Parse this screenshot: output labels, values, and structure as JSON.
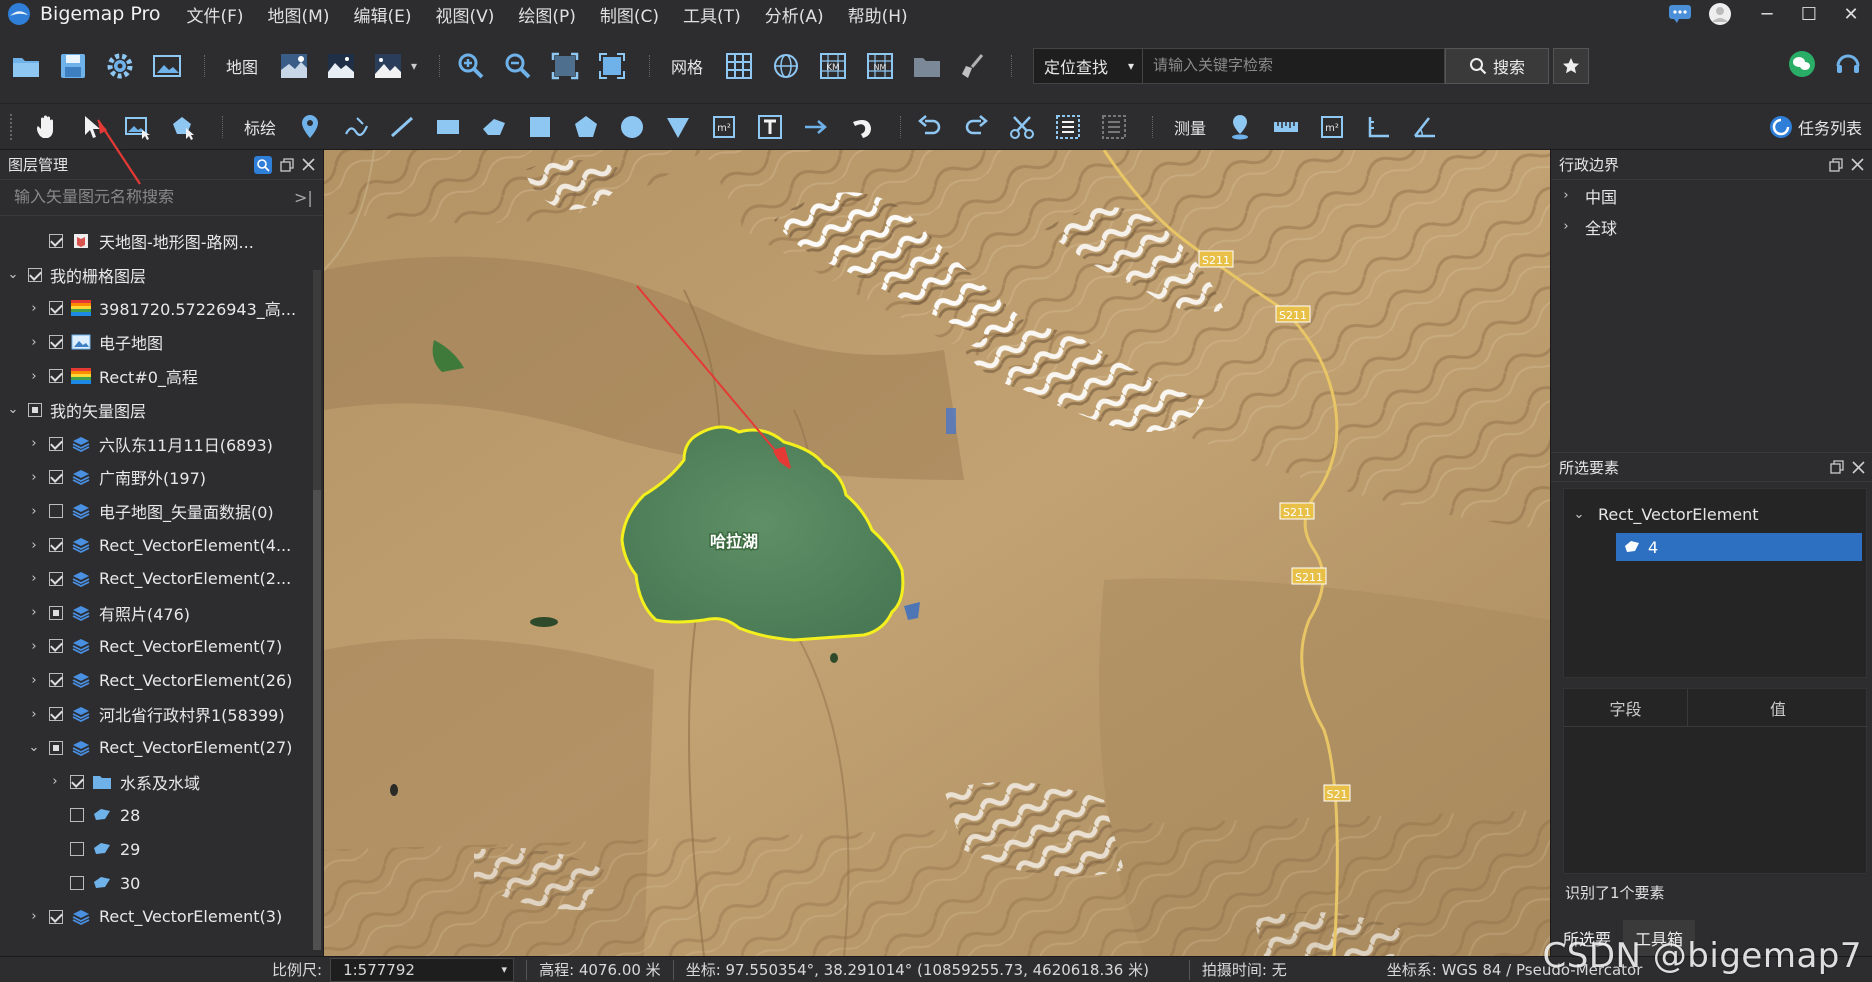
{
  "app": {
    "title": "Bigemap Pro"
  },
  "menu": [
    "文件(F)",
    "地图(M)",
    "编辑(E)",
    "视图(V)",
    "绘图(P)",
    "制图(C)",
    "工具(T)",
    "分析(A)",
    "帮助(H)"
  ],
  "toolbar1": {
    "map_label": "地图",
    "grid_label": "网格",
    "locate_select": "定位查找",
    "search_placeholder": "请输入关键字检索",
    "search_button": "搜索"
  },
  "toolbar2": {
    "annotate_label": "标绘",
    "measure_label": "测量",
    "task_list": "任务列表"
  },
  "layer_panel": {
    "title": "图层管理",
    "search_placeholder": "输入矢量图元名称搜索",
    "rows": [
      {
        "depth": 1,
        "arrow": "",
        "check": "on",
        "icon": "map-book",
        "label": "天地图-地形图-路网..."
      },
      {
        "depth": 0,
        "arrow": "v",
        "check": "on",
        "icon": "",
        "label": "我的栅格图层"
      },
      {
        "depth": 1,
        "arrow": ">",
        "check": "on",
        "icon": "rainbow",
        "label": "3981720.57226943_高..."
      },
      {
        "depth": 1,
        "arrow": ">",
        "check": "on",
        "icon": "image",
        "label": "电子地图"
      },
      {
        "depth": 1,
        "arrow": ">",
        "check": "on",
        "icon": "rainbow",
        "label": "Rect#0_高程"
      },
      {
        "depth": 0,
        "arrow": "v",
        "check": "part",
        "icon": "",
        "label": "我的矢量图层"
      },
      {
        "depth": 1,
        "arrow": ">",
        "check": "on",
        "icon": "layers",
        "label": "六队东11月11日(6893)"
      },
      {
        "depth": 1,
        "arrow": ">",
        "check": "on",
        "icon": "layers",
        "label": "广南野外(197)"
      },
      {
        "depth": 1,
        "arrow": ">",
        "check": "off",
        "icon": "layers",
        "label": "电子地图_矢量面数据(0)"
      },
      {
        "depth": 1,
        "arrow": ">",
        "check": "on",
        "icon": "layers",
        "label": "Rect_VectorElement(4..."
      },
      {
        "depth": 1,
        "arrow": ">",
        "check": "on",
        "icon": "layers",
        "label": "Rect_VectorElement(2..."
      },
      {
        "depth": 1,
        "arrow": ">",
        "check": "part",
        "icon": "layers",
        "label": "有照片(476)"
      },
      {
        "depth": 1,
        "arrow": ">",
        "check": "on",
        "icon": "layers",
        "label": "Rect_VectorElement(7)"
      },
      {
        "depth": 1,
        "arrow": ">",
        "check": "on",
        "icon": "layers",
        "label": "Rect_VectorElement(26)"
      },
      {
        "depth": 1,
        "arrow": ">",
        "check": "on",
        "icon": "layers",
        "label": "河北省行政村界1(58399)"
      },
      {
        "depth": 1,
        "arrow": "v",
        "check": "part",
        "icon": "layers",
        "label": "Rect_VectorElement(27)"
      },
      {
        "depth": 2,
        "arrow": ">",
        "check": "on",
        "icon": "folder",
        "label": "水系及水域"
      },
      {
        "depth": 2,
        "arrow": "",
        "check": "off",
        "icon": "polygon",
        "label": "28"
      },
      {
        "depth": 2,
        "arrow": "",
        "check": "off",
        "icon": "polygon",
        "label": "29"
      },
      {
        "depth": 2,
        "arrow": "",
        "check": "off",
        "icon": "polygon",
        "label": "30"
      },
      {
        "depth": 1,
        "arrow": ">",
        "check": "on",
        "icon": "layers",
        "label": "Rect_VectorElement(3)"
      }
    ]
  },
  "map": {
    "lake_label": "哈拉湖",
    "road_labels": [
      "S211",
      "S211",
      "S211",
      "S211",
      "S21"
    ]
  },
  "admin_panel": {
    "title": "行政边界",
    "items": [
      "中国",
      "全球"
    ]
  },
  "selected_panel": {
    "title": "所选要素",
    "group": "Rect_VectorElement",
    "selected_item": "4",
    "col_field": "字段",
    "col_value": "值",
    "recognized": "识别了1个要素",
    "tabs": [
      "所选要",
      "工具箱"
    ]
  },
  "statusbar": {
    "scale_label": "比例尺:",
    "scale_value": "1:577792",
    "elevation": "高程: 4076.00 米",
    "coords": "坐标: 97.550354°, 38.291014°  (10859255.73, 4620618.36 米)",
    "capture_time": "拍摄时间: 无",
    "crs": "坐标系: WGS 84 / Pseudo-Mercator"
  },
  "watermark": "CSDN @bigemap7",
  "colors": {
    "accent": "#2d6fc0",
    "lake_outline": "#f4f01e",
    "arrow_red": "#e53935"
  }
}
